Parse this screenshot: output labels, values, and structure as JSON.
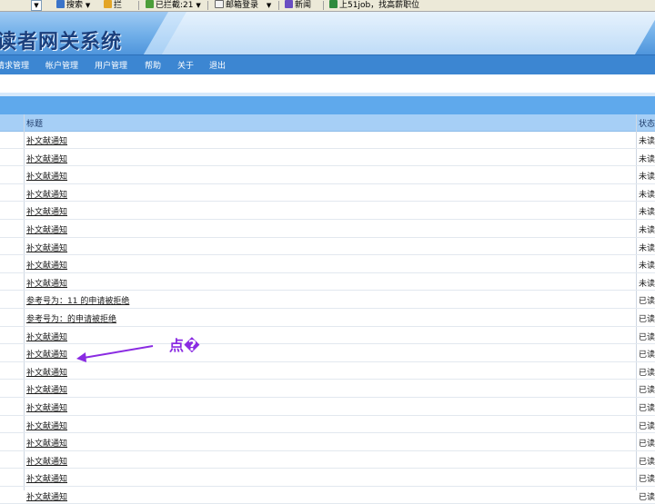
{
  "toolbar": {
    "dropdown_glyph": "▼",
    "search_label": "搜索",
    "favorites_label": "拦",
    "blocked_label": "已拦截:21",
    "email_label": "邮箱登录",
    "news_label": "新闻",
    "game_label": "上51job，找高薪职位"
  },
  "banner": {
    "title": "读者网关系统"
  },
  "menu": {
    "items": [
      "请求管理",
      "帐户管理",
      "用户管理",
      "帮助",
      "关于",
      "退出"
    ]
  },
  "table": {
    "headers": {
      "title": "标题",
      "status": "状态"
    },
    "rows": [
      {
        "title": "补文献通知",
        "status": "未读"
      },
      {
        "title": "补文献通知",
        "status": "未读"
      },
      {
        "title": "补文献通知",
        "status": "未读"
      },
      {
        "title": "补文献通知",
        "status": "未读"
      },
      {
        "title": "补文献通知",
        "status": "未读"
      },
      {
        "title": "补文献通知",
        "status": "未读"
      },
      {
        "title": "补文献通知",
        "status": "未读"
      },
      {
        "title": "补文献通知",
        "status": "未读"
      },
      {
        "title": "补文献通知",
        "status": "未读"
      },
      {
        "title": "参考号为：11 的申请被拒绝",
        "status": "已读"
      },
      {
        "title": "参考号为：的申请被拒绝",
        "status": "已读"
      },
      {
        "title": "补文献通知",
        "status": "已读"
      },
      {
        "title": "补文献通知",
        "status": "已读"
      },
      {
        "title": "补文献通知",
        "status": "已读"
      },
      {
        "title": "补文献通知",
        "status": "已读"
      },
      {
        "title": "补文献通知",
        "status": "已读"
      },
      {
        "title": "补文献通知",
        "status": "已读"
      },
      {
        "title": "补文献通知",
        "status": "已读"
      },
      {
        "title": "补文献通知",
        "status": "已读"
      },
      {
        "title": "补文献通知",
        "status": "已读"
      },
      {
        "title": "补文献通知",
        "status": "已读"
      }
    ]
  },
  "annotation": {
    "text": "点�",
    "color": "#8a2be2"
  },
  "colors": {
    "menubar": "#3c86d2",
    "header": "#a6cff6",
    "title_text": "#1b3f7c"
  }
}
